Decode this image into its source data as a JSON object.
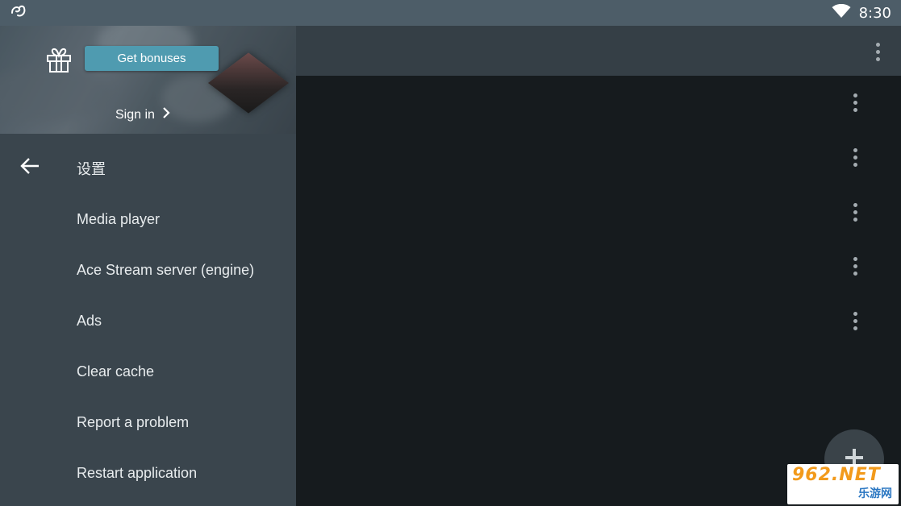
{
  "status_bar": {
    "time": "8:30",
    "app_icon": "ace-stream-logo",
    "wifi_icon": "wifi-icon"
  },
  "drawer": {
    "header": {
      "bonus_button": "Get bonuses",
      "sign_in": "Sign in",
      "gift_icon": "gift-icon",
      "chevron_icon": "chevron-right-icon"
    },
    "section": {
      "title": "设置",
      "back_icon": "arrow-back-icon"
    },
    "items": [
      {
        "label": "Media player"
      },
      {
        "label": "Ace Stream server (engine)"
      },
      {
        "label": "Ads"
      },
      {
        "label": "Clear cache"
      },
      {
        "label": "Report a problem"
      },
      {
        "label": "Restart application"
      }
    ]
  },
  "appbar": {
    "overflow_icon": "more-vert-icon"
  },
  "list": {
    "row_count_icons": "more-vert-icon"
  },
  "fab": {
    "icon": "plus-icon"
  },
  "watermark": {
    "top": "962.NET",
    "bottom": "乐游网"
  },
  "colors": {
    "status_bar": "#4d5d68",
    "drawer": "#3a454d",
    "appbar": "#353f46",
    "content": "#161b1e",
    "accent": "#4f9bb0"
  }
}
